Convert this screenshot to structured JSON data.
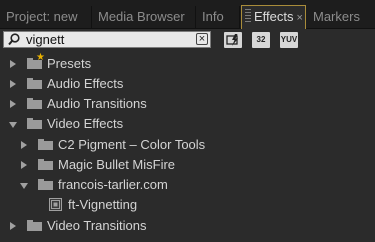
{
  "tabs": [
    {
      "label": "Project: new"
    },
    {
      "label": "Media Browser"
    },
    {
      "label": "Info"
    },
    {
      "label": "Effects",
      "active": true,
      "close": "×"
    },
    {
      "label": "Markers"
    }
  ],
  "search": {
    "value": "vignett",
    "clear_glyph": "×"
  },
  "toolbar": {
    "accelerated_label": "",
    "bit32_label": "32",
    "yuv_label": "YUV"
  },
  "tree": [
    {
      "label": "Presets",
      "expanded": false,
      "icon": "preset-folder-icon"
    },
    {
      "label": "Audio Effects",
      "expanded": false,
      "icon": "folder-icon"
    },
    {
      "label": "Audio Transitions",
      "expanded": false,
      "icon": "folder-icon"
    },
    {
      "label": "Video Effects",
      "expanded": true,
      "icon": "folder-icon"
    },
    {
      "label": "C2 Pigment – Color Tools",
      "expanded": false,
      "icon": "folder-icon"
    },
    {
      "label": "Magic Bullet MisFire",
      "expanded": false,
      "icon": "folder-icon"
    },
    {
      "label": "francois-tarlier.com",
      "expanded": true,
      "icon": "folder-icon"
    },
    {
      "label": "ft-Vignetting",
      "icon": "effect-icon"
    },
    {
      "label": "Video Transitions",
      "expanded": false,
      "icon": "folder-icon"
    }
  ],
  "colors": {
    "panel_bg": "#2b2b2b",
    "tab_bar_bg": "#1d1d1d",
    "active_tab_border": "#a98c3a",
    "preset_star": "#e8b000"
  }
}
